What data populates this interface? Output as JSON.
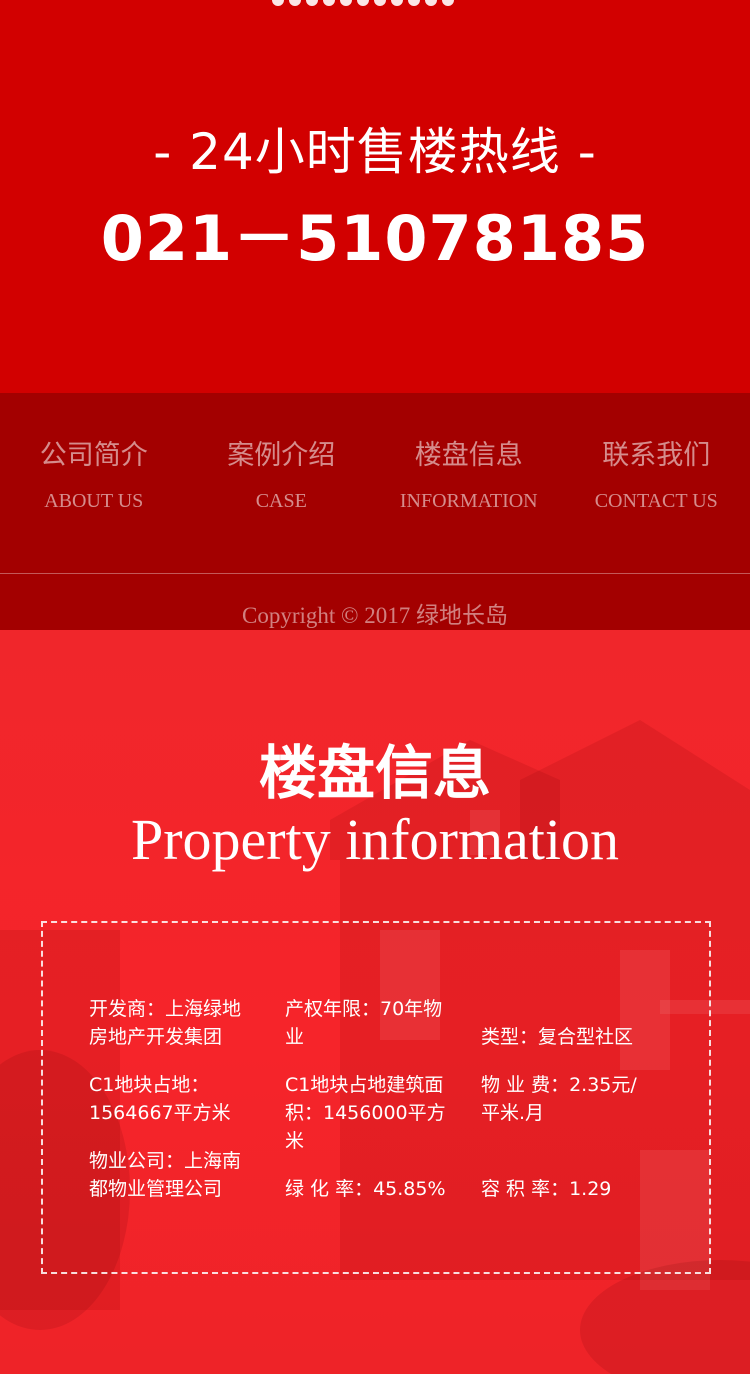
{
  "hotline": {
    "title": "- 24小时售楼热线 -",
    "phone": "021－51078185"
  },
  "nav": {
    "items": [
      {
        "cn": "公司简介",
        "en": "ABOUT US"
      },
      {
        "cn": "案例介绍",
        "en": "CASE"
      },
      {
        "cn": "楼盘信息",
        "en": "INFORMATION"
      },
      {
        "cn": "联系我们",
        "en": "CONTACT US"
      }
    ]
  },
  "footer": {
    "copyright": "Copyright © 2017 绿地长岛"
  },
  "property": {
    "title": "楼盘信息",
    "subtitle": "Property information",
    "rows": [
      [
        "开发商：上海绿地房地产开发集团",
        "产权年限：70年物业",
        "类型：复合型社区"
      ],
      [
        "C1地块占地：1564667平方米",
        "C1地块占地建筑面积：1456000平方米",
        "物 业 费：2.35元/平米.月"
      ],
      [
        "物业公司：上海南都物业管理公司",
        "绿 化 率：45.85%",
        "容 积 率：1.29"
      ]
    ]
  },
  "colors": {
    "hotline_bg": "#d20000",
    "nav_bg": "#a30000",
    "property_bg": "#f0262b"
  }
}
